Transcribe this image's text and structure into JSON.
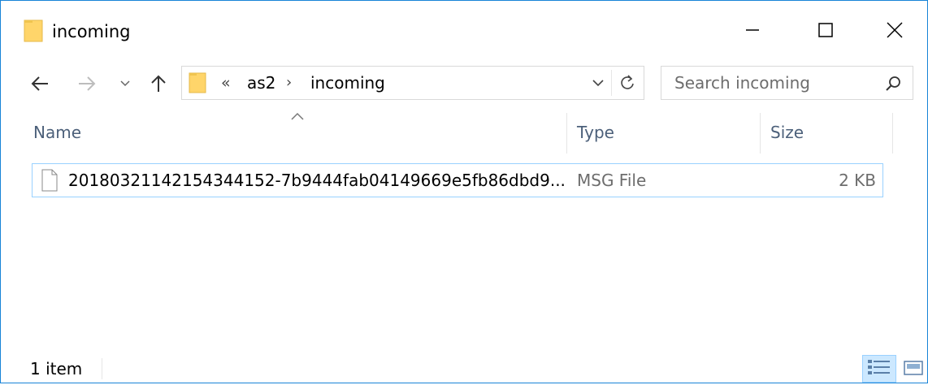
{
  "window": {
    "title": "incoming",
    "accent_color": "#1883d7"
  },
  "address": {
    "overflow_chevron": "«",
    "path": [
      "as2",
      "incoming"
    ],
    "separator": "›"
  },
  "search": {
    "placeholder": "Search incoming"
  },
  "columns": {
    "name": "Name",
    "type": "Type",
    "size": "Size",
    "sorted_by": "Name"
  },
  "files": [
    {
      "name": "20180321142154344152-7b9444fab04149669e5fb86dbd9...",
      "type": "MSG File",
      "size": "2 KB"
    }
  ],
  "status": {
    "item_count": "1 item"
  },
  "icons": {
    "title_folder": "folder-icon",
    "back": "arrow-left-icon",
    "forward": "arrow-right-icon",
    "recent": "chevron-down-icon",
    "up": "arrow-up-icon",
    "address_dropdown": "chevron-down-icon",
    "refresh": "refresh-icon",
    "search": "search-icon",
    "file": "file-icon",
    "details_view": "details-view-icon",
    "tiles_view": "large-icons-view-icon"
  }
}
